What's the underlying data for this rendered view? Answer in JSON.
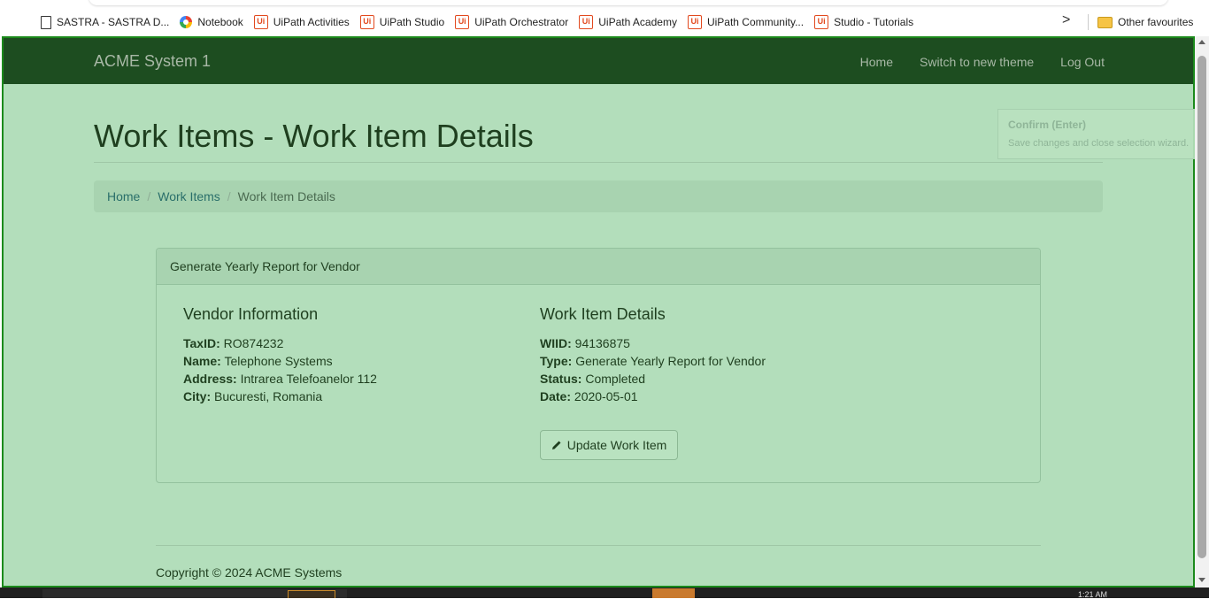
{
  "bookmarks": [
    {
      "label": "SASTRA - SASTRA D...",
      "icon": "page-icon"
    },
    {
      "label": "Notebook",
      "icon": "notebook-icon"
    },
    {
      "label": "UiPath Activities",
      "icon": "uipath-icon"
    },
    {
      "label": "UiPath Studio",
      "icon": "uipath-icon"
    },
    {
      "label": "UiPath Orchestrator",
      "icon": "uipath-icon"
    },
    {
      "label": "UiPath Academy",
      "icon": "uipath-icon"
    },
    {
      "label": "UiPath Community...",
      "icon": "uipath-icon"
    },
    {
      "label": "Studio - Tutorials",
      "icon": "uipath-icon"
    }
  ],
  "bookmarks_overflow": ">",
  "other_favourites": "Other favourites",
  "uipath_icon_text": "Ui",
  "navbar": {
    "brand": "ACME System 1",
    "links": [
      "Home",
      "Switch to new theme",
      "Log Out"
    ]
  },
  "page_title": "Work Items - Work Item Details",
  "breadcrumb": {
    "home": "Home",
    "separator": "/",
    "work_items": "Work Items",
    "current": "Work Item Details"
  },
  "panel": {
    "heading": "Generate Yearly Report for Vendor",
    "vendor": {
      "title": "Vendor Information",
      "taxid_label": "TaxID:",
      "taxid": "RO874232",
      "name_label": "Name:",
      "name": "Telephone Systems",
      "address_label": "Address:",
      "address": "Intrarea Telefoanelor 112",
      "city_label": "City:",
      "city": "Bucuresti, Romania"
    },
    "details": {
      "title": "Work Item Details",
      "wiid_label": "WIID:",
      "wiid": "94136875",
      "type_label": "Type:",
      "type": "Generate Yearly Report for Vendor",
      "status_label": "Status:",
      "status": "Completed",
      "date_label": "Date:",
      "date": "2020-05-01"
    },
    "update_button": "Update Work Item"
  },
  "footer": "Copyright © 2024 ACME Systems",
  "tooltip": {
    "title": "Confirm (Enter)",
    "description": "Save changes and close selection wizard."
  },
  "taskbar_clock": "1:21 AM",
  "colors": {
    "navbar": "#1d4d20",
    "overlay": "#b3debb",
    "highlight_border": "#1b8a1b"
  }
}
